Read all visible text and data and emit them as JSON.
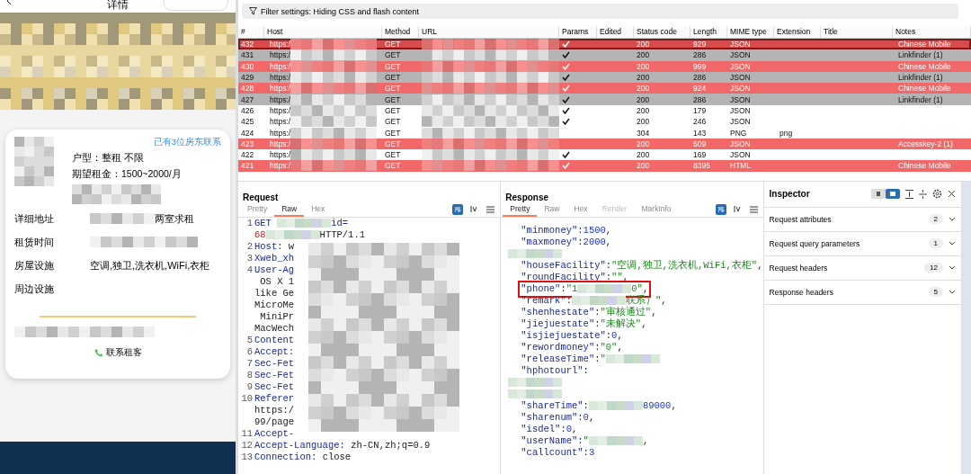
{
  "phone": {
    "title": "详情",
    "badge": "已有3位房东联系",
    "layout": "户型：整租 不限",
    "budget": "期望租金：1500~2000/月",
    "details": [
      {
        "label": "详细地址",
        "value": "两室求租",
        "redacted": true
      },
      {
        "label": "租赁时间",
        "redacted": true
      },
      {
        "label": "房屋设施",
        "value": "空调,独卫,洗衣机,WiFi,衣柜",
        "redacted": false
      },
      {
        "label": "周边设施",
        "redacted": false
      }
    ],
    "contact_button": "联系租客"
  },
  "filter": "Filter settings: Hiding CSS and flash content",
  "table": {
    "columns": [
      "#",
      "Host",
      "Method",
      "URL",
      "Params",
      "Edited",
      "Status code",
      "Length",
      "MIME type",
      "Extension",
      "Title",
      "Notes"
    ],
    "rows": [
      {
        "num": "432",
        "host": "https:/",
        "method": "GET",
        "params": true,
        "status": "200",
        "length": "929",
        "mime": "JSON",
        "notes": "Chinese Mobile",
        "color": "#d94a4a",
        "selected": true
      },
      {
        "num": "431",
        "host": "https:/",
        "method": "GET",
        "params": true,
        "status": "200",
        "length": "286",
        "mime": "JSON",
        "notes": "Linkfinder (1)",
        "color": "#b4b4b4",
        "selected": false
      },
      {
        "num": "430",
        "host": "https:/",
        "method": "GET",
        "params": true,
        "status": "200",
        "length": "999",
        "mime": "JSON",
        "notes": "Chinese Mobile",
        "color": "#f26868",
        "selected": false
      },
      {
        "num": "429",
        "host": "https:/",
        "method": "GET",
        "params": true,
        "status": "200",
        "length": "286",
        "mime": "JSON",
        "notes": "Linkfinder (1)",
        "color": "#b4b4b4",
        "selected": false
      },
      {
        "num": "428",
        "host": "https:/",
        "method": "GET",
        "params": true,
        "status": "200",
        "length": "924",
        "mime": "JSON",
        "notes": "Chinese Mobile",
        "color": "#f26868",
        "selected": false
      },
      {
        "num": "427",
        "host": "https:/",
        "method": "GET",
        "params": true,
        "status": "200",
        "length": "286",
        "mime": "JSON",
        "notes": "Linkfinder (1)",
        "color": "#b4b4b4",
        "selected": false
      },
      {
        "num": "426",
        "host": "https:/",
        "method": "GET",
        "params": true,
        "status": "200",
        "length": "179",
        "mime": "JSON",
        "selected": false
      },
      {
        "num": "425",
        "host": "https:/",
        "method": "GET",
        "params": true,
        "status": "200",
        "length": "246",
        "mime": "JSON",
        "selected": false
      },
      {
        "num": "424",
        "host": "https:/",
        "method": "GET",
        "params": false,
        "status": "304",
        "length": "143",
        "mime": "PNG",
        "extension": "png",
        "selected": false
      },
      {
        "num": "423",
        "host": "https:/",
        "method": "GET",
        "params": false,
        "status": "200",
        "length": "509",
        "mime": "JSON",
        "notes": "Accesskey-2 (1)",
        "color": "#f26868",
        "selected": false
      },
      {
        "num": "422",
        "host": "https:/",
        "method": "GET",
        "params": true,
        "status": "200",
        "length": "169",
        "mime": "JSON",
        "selected": false
      },
      {
        "num": "421",
        "host": "https:/",
        "method": "GET",
        "params": true,
        "status": "200",
        "length": "8395",
        "mime": "HTML",
        "notes": "Chinese Mobile",
        "color": "#f26868",
        "selected": false
      }
    ]
  },
  "request": {
    "title": "Request",
    "tabs": [
      {
        "label": "Pretty",
        "selected": false
      },
      {
        "label": "Raw",
        "selected": true
      },
      {
        "label": "Hex",
        "selected": false
      }
    ],
    "lines": [
      {
        "n": "1",
        "segs": [
          {
            "kind": "key",
            "text": "GET "
          },
          {
            "kind": "redacted"
          },
          {
            "kind": "key",
            "text": "id="
          }
        ]
      },
      {
        "segs": [
          {
            "kind": "error",
            "text": "68"
          },
          {
            "kind": "redacted"
          },
          {
            "kind": "plain",
            "text": "HTTP/1.1"
          }
        ]
      },
      {
        "n": "2",
        "segs": [
          {
            "kind": "key",
            "text": "Host: "
          },
          {
            "kind": "plain",
            "text": "w"
          }
        ]
      },
      {
        "n": "3",
        "segs": [
          {
            "kind": "key",
            "text": "Xweb_xh"
          }
        ]
      },
      {
        "n": "4",
        "segs": [
          {
            "kind": "key",
            "text": "User-Ag"
          }
        ]
      },
      {
        "segs": [
          {
            "kind": "plain",
            "text": " OS X 1"
          }
        ]
      },
      {
        "segs": [
          {
            "kind": "plain",
            "text": "like Ge"
          }
        ]
      },
      {
        "segs": [
          {
            "kind": "plain",
            "text": "MicroMe"
          }
        ]
      },
      {
        "segs": [
          {
            "kind": "plain",
            "text": " MiniPr"
          }
        ]
      },
      {
        "segs": [
          {
            "kind": "plain",
            "text": "MacWech"
          }
        ]
      },
      {
        "n": "5",
        "segs": [
          {
            "kind": "key",
            "text": "Content"
          }
        ]
      },
      {
        "n": "6",
        "segs": [
          {
            "kind": "key",
            "text": "Accept:"
          }
        ]
      },
      {
        "n": "7",
        "segs": [
          {
            "kind": "key",
            "text": "Sec-Fet"
          }
        ]
      },
      {
        "n": "8",
        "segs": [
          {
            "kind": "key",
            "text": "Sec-Fet"
          }
        ]
      },
      {
        "n": "9",
        "segs": [
          {
            "kind": "key",
            "text": "Sec-Fet"
          }
        ]
      },
      {
        "n": "10",
        "segs": [
          {
            "kind": "key",
            "text": "Referer"
          }
        ]
      },
      {
        "segs": [
          {
            "kind": "plain",
            "text": "https:/"
          }
        ]
      },
      {
        "segs": [
          {
            "kind": "plain",
            "text": "99/page"
          }
        ]
      },
      {
        "n": "11",
        "segs": [
          {
            "kind": "key",
            "text": "Accept-"
          }
        ]
      },
      {
        "n": "12",
        "segs": [
          {
            "kind": "key",
            "text": "Accept-Language: "
          },
          {
            "kind": "plain",
            "text": "zh-CN,zh;q=0.9"
          }
        ]
      },
      {
        "n": "13",
        "segs": [
          {
            "kind": "key",
            "text": "Connection: "
          },
          {
            "kind": "plain",
            "text": "close"
          }
        ]
      }
    ]
  },
  "response": {
    "title": "Response",
    "tabs": [
      {
        "label": "Pretty",
        "selected": true,
        "disabled": false
      },
      {
        "label": "Raw",
        "selected": false,
        "disabled": false
      },
      {
        "label": "Hex",
        "selected": false,
        "disabled": false
      },
      {
        "label": "Render",
        "selected": false,
        "disabled": true
      },
      {
        "label": "MarkInfo",
        "selected": false,
        "disabled": false
      }
    ],
    "lines": [
      {
        "segs": [
          {
            "kind": "key",
            "text": "\"minmoney\""
          },
          {
            "kind": "plain",
            "text": ":"
          },
          {
            "kind": "number",
            "text": "1500"
          },
          {
            "kind": "plain",
            "text": ","
          }
        ]
      },
      {
        "segs": [
          {
            "kind": "key",
            "text": "\"maxmoney\""
          },
          {
            "kind": "plain",
            "text": ":"
          },
          {
            "kind": "number",
            "text": "2000"
          },
          {
            "kind": "plain",
            "text": ","
          }
        ]
      },
      {
        "segs": [
          {
            "kind": "redacted"
          }
        ]
      },
      {
        "segs": [
          {
            "kind": "key",
            "text": "\"houseFacility\""
          },
          {
            "kind": "plain",
            "text": ":"
          },
          {
            "kind": "string",
            "text": "\"空调,独卫,洗衣机,WiFi,衣柜\""
          },
          {
            "kind": "plain",
            "text": ","
          }
        ]
      },
      {
        "segs": [
          {
            "kind": "key",
            "text": "\"roundFacility\""
          },
          {
            "kind": "plain",
            "text": ":"
          },
          {
            "kind": "string",
            "text": "\"\""
          },
          {
            "kind": "plain",
            "text": ","
          }
        ]
      },
      {
        "highlighted": true,
        "segs": [
          {
            "kind": "key",
            "text": "\"phone\""
          },
          {
            "kind": "plain",
            "text": ":"
          },
          {
            "kind": "string",
            "text": "\"1"
          },
          {
            "kind": "redacted"
          },
          {
            "kind": "string",
            "text": "0\""
          },
          {
            "kind": "plain",
            "text": ","
          }
        ]
      },
      {
        "segs": [
          {
            "kind": "key",
            "text": "\"remark\""
          },
          {
            "kind": "plain",
            "text": ":"
          },
          {
            "kind": "redacted"
          },
          {
            "kind": "string",
            "text": "联系）\""
          },
          {
            "kind": "plain",
            "text": ","
          }
        ]
      },
      {
        "segs": [
          {
            "kind": "key",
            "text": "\"shenhestate\""
          },
          {
            "kind": "plain",
            "text": ":"
          },
          {
            "kind": "string",
            "text": "\"审核通过\""
          },
          {
            "kind": "plain",
            "text": ","
          }
        ]
      },
      {
        "segs": [
          {
            "kind": "key",
            "text": "\"jiejuestate\""
          },
          {
            "kind": "plain",
            "text": ":"
          },
          {
            "kind": "string",
            "text": "\"未解决\""
          },
          {
            "kind": "plain",
            "text": ","
          }
        ]
      },
      {
        "segs": [
          {
            "kind": "key",
            "text": "\"isjiejuestate\""
          },
          {
            "kind": "plain",
            "text": ":"
          },
          {
            "kind": "number",
            "text": "0"
          },
          {
            "kind": "plain",
            "text": ","
          }
        ]
      },
      {
        "segs": [
          {
            "kind": "key",
            "text": "\"rewordmoney\""
          },
          {
            "kind": "plain",
            "text": ":"
          },
          {
            "kind": "string",
            "text": "\"0\""
          },
          {
            "kind": "plain",
            "text": ","
          }
        ]
      },
      {
        "segs": [
          {
            "kind": "key",
            "text": "\"releaseTime\""
          },
          {
            "kind": "plain",
            "text": ":"
          },
          {
            "kind": "string",
            "text": "\""
          },
          {
            "kind": "redacted"
          }
        ]
      },
      {
        "segs": [
          {
            "kind": "key",
            "text": "\"hphotourl\""
          },
          {
            "kind": "plain",
            "text": ":"
          }
        ]
      },
      {
        "segs": [
          {
            "kind": "redacted"
          }
        ]
      },
      {
        "segs": [
          {
            "kind": "redacted"
          }
        ]
      },
      {
        "segs": [
          {
            "kind": "key",
            "text": "\"shareTime\""
          },
          {
            "kind": "plain",
            "text": ":"
          },
          {
            "kind": "redacted"
          },
          {
            "kind": "number",
            "text": "89000"
          },
          {
            "kind": "plain",
            "text": ","
          }
        ]
      },
      {
        "segs": [
          {
            "kind": "key",
            "text": "\"sharenum\""
          },
          {
            "kind": "plain",
            "text": ":"
          },
          {
            "kind": "number",
            "text": "0"
          },
          {
            "kind": "plain",
            "text": ","
          }
        ]
      },
      {
        "segs": [
          {
            "kind": "key",
            "text": "\"isdel\""
          },
          {
            "kind": "plain",
            "text": ":"
          },
          {
            "kind": "number",
            "text": "0"
          },
          {
            "kind": "plain",
            "text": ","
          }
        ]
      },
      {
        "segs": [
          {
            "kind": "key",
            "text": "\"userName\""
          },
          {
            "kind": "plain",
            "text": ":"
          },
          {
            "kind": "string",
            "text": "\""
          },
          {
            "kind": "redacted"
          },
          {
            "kind": "plain",
            "text": ","
          }
        ]
      },
      {
        "segs": [
          {
            "kind": "key",
            "text": "\"callcount\""
          },
          {
            "kind": "plain",
            "text": ":"
          },
          {
            "kind": "number",
            "text": "3"
          }
        ]
      }
    ]
  },
  "inspector": {
    "title": "Inspector",
    "sections": [
      {
        "label": "Request attributes",
        "count": "2"
      },
      {
        "label": "Request query parameters",
        "count": "1"
      },
      {
        "label": "Request headers",
        "count": "12"
      },
      {
        "label": "Response headers",
        "count": "5"
      }
    ]
  }
}
